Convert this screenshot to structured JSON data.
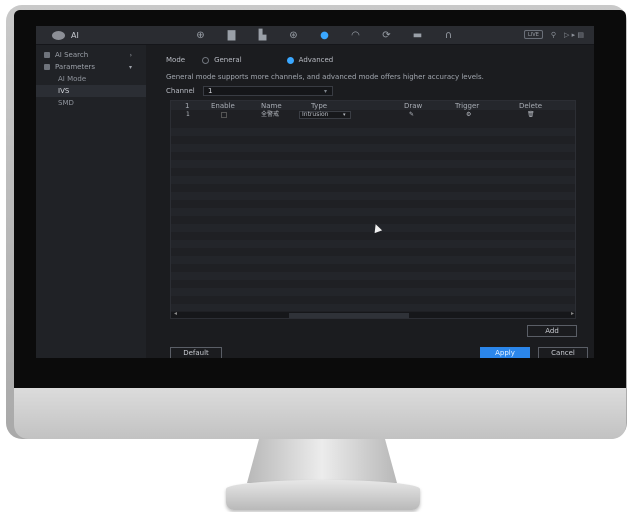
{
  "app": {
    "title": "AI"
  },
  "nav": {
    "icons": [
      {
        "name": "camera-icon",
        "glyph": "⊕"
      },
      {
        "name": "folder-icon",
        "glyph": "▇"
      },
      {
        "name": "chart-icon",
        "glyph": "▙"
      },
      {
        "name": "network-icon",
        "glyph": "⊛"
      },
      {
        "name": "ai-icon",
        "glyph": "●",
        "active": true
      },
      {
        "name": "gauge-icon",
        "glyph": "◠"
      },
      {
        "name": "refresh-icon",
        "glyph": "⟳"
      },
      {
        "name": "monitor-icon",
        "glyph": "▬"
      },
      {
        "name": "headset-icon",
        "glyph": "∩"
      }
    ],
    "live_badge": "LIVE",
    "user": "⚲",
    "status": "▷ ▸ ▤"
  },
  "sidebar": {
    "items": [
      {
        "label": "AI Search",
        "level": 0,
        "has_chevron": true,
        "chevron": "›"
      },
      {
        "label": "Parameters",
        "level": 0,
        "has_chevron": true,
        "chevron": "▾"
      },
      {
        "label": "AI Mode",
        "level": 1
      },
      {
        "label": "IVS",
        "level": 1,
        "selected": true
      },
      {
        "label": "SMD",
        "level": 1
      }
    ]
  },
  "main": {
    "mode_label": "Mode",
    "mode_general": "General",
    "mode_advanced": "Advanced",
    "description": "General mode supports more channels, and advanced mode offers higher accuracy levels.",
    "channel_label": "Channel",
    "channel_value": "1"
  },
  "table": {
    "headers": [
      "1",
      "Enable",
      "Name",
      "Type",
      "Draw",
      "Trigger",
      "Delete"
    ],
    "rows": [
      {
        "index": "1",
        "enable": "",
        "name": "全警戒",
        "type": "Intrusion",
        "draw": "✎",
        "trigger": "⚙",
        "delete": "🗑"
      }
    ],
    "empty_rows": 20
  },
  "buttons": {
    "add": "Add",
    "default": "Default",
    "apply": "Apply",
    "cancel": "Cancel"
  },
  "colors": {
    "accent": "#2b86ea",
    "bg": "#1b1c1f"
  }
}
